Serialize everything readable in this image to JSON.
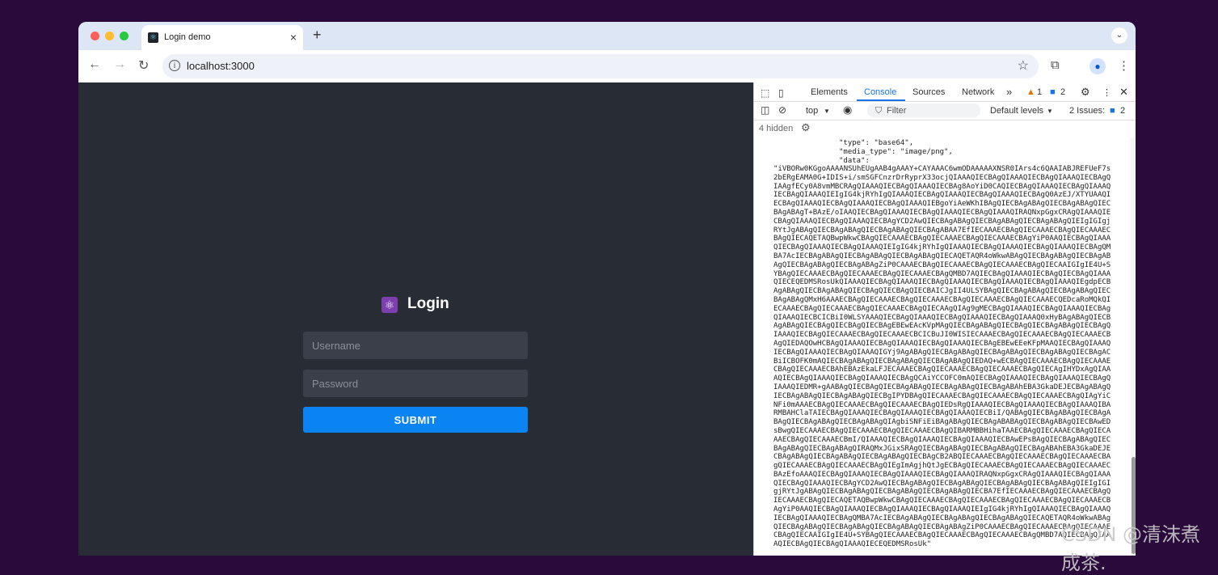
{
  "browser": {
    "tab_title": "Login demo",
    "tab_close": "×",
    "new_tab": "+",
    "tab_menu": "⌄",
    "url": "localhost:3000",
    "colors": {
      "close_dot": "#ff5f57",
      "min_dot": "#febc2e",
      "max_dot": "#28c840"
    }
  },
  "app": {
    "title": "Login",
    "username_placeholder": "Username",
    "password_placeholder": "Password",
    "submit_label": "SUBMIT"
  },
  "devtools": {
    "tabs": [
      "Elements",
      "Console",
      "Sources",
      "Network"
    ],
    "more": "»",
    "warnings": "1",
    "messages": "2",
    "context": "top",
    "filter_placeholder": "Filter",
    "levels": "Default levels",
    "issues_label": "2 Issues:",
    "issues_count": "2",
    "hidden_label": "4 hidden",
    "console": {
      "type_line": "\"type\": \"base64\",",
      "media_line": "\"media_type\": \"image/png\",",
      "data_key": "\"data\":",
      "data_value": "\"iVBORw0KGgoAAAANSUhEUgAAB4gAAAY+CAYAAAC6wmODAAAAAXNSR0IArs4c6QAAIABJREFUeF7s2bERgEAMA0G+IDIS+i/smSGFCnzrDrRyprX33ocjQIAAAQIECBAgQIAAAQIECBAgQIAAAQIECBAgQIAAgfECy0A8vmMBCRAgQIAAAQIECBAgQIAAAQIECBAg8AoYiD0CAQIECBAgQIAAAQIECBAgQIAAAQIECBAgQIAAAQIEIgIG4kjRYhIgQIAAAQIECBAgQIAAAQIECBAgQIAAAQIECBAgQ0AzEJ/XTYUAAQIECBAgQIAAAQIECBAgQIAAAQIECBAgQIAAAQIEBgoYiAeWKhIBAgQIECBAgABAgQIECBAgABAgQIECBAgABAgT+BAzE/oIAAQIECBAgQIAAAQIECBAgQIAAAQIECBAgQIAAAQIRAQNxpGgxCRAgQIAAAQIECBAgQIAAAQIECBAgQIAAAQIECBAgYCD2AwQIECBAgABAgQIECBAgABAgQIECBAgABAgQIEIgIGIgjRYtJgABAgQIECBAgABAgQIECBAgABAgQIECBAgABAA7EfIECAAAECBAgQIECAAAECBAgQIECAAAECBAgQIECAQETAQBwpWkwCBAgQIECAAAECBAgQIECAAAECBAgQIECAAAECBAgYiP0AAQIECBAgQIAAAQIECBAgQIAAAQIECBAgQIAAAQIEIgIG4kjRYhIgQIAAAQIECBAgQIAAAQIECBAgQIAAAQIECBAgQMBA7AcIECBAgABAgQIECBAgABAgQIECBAgABAgQIECAQETAQR4oWkwABAgQIECBAgABAgQIECBAgABAgQIECBAgABAgQIECBAgABAgZiP0CAAAECBAgQIECAAAECBAgQIECAAAECBAgQIECAAIGIgIE4U+SYBAgQIECAAAECBAgQIECAAAECBAgQIECAAAECBAgQMBD7AQIECBAgQIAAAQIECBAgQIECBAgQIAAAQIECEQEDMSRosUkQIAAAQIECBAgQIAAAQIECBAgQIAAAQIECBAgQIAAAQIECBAgQIAAAQIEgdpECBAgABAgQIECBAgABAgQIECBAgQIECBAgQIECBAICJgII4ULSYBAgQIECBAgABAgQIECBAgABAgQIECBAgABAgQMxH6AAAECBAgQIECAAAECBAgQIECAAAECBAgQIECAAAECBAgQIECAAAECQEDcaRoMQkQIECAAAECBAgQIECAAAECBAgQIECAAAECBAgQIECAAgQIAg9gMECBAgQIAAAQIECBAgQIAAAQIECBAgQIAAAQIECBCICBiI0WLSYAAAQIECBAgQIAAAQIECBAgQIAAAQIECBAgQIAAAQ0xHyBAgABAgQIECBAgABAgQIECBAgQIECBAgQIECBAgEBEwEAcKVpMAgQIECBAgABAgQIECBAgQIECBAgABAgQIECBAgQIAAAQIECBAgQIECAAAECBAgQIECAAAECBCICBuJI0WISIECAAAECBAgQIECAAAECBAgQIECAAAECBAgQIEDAQOwHCBAgQIAAAQIECBAgQIAAAQIECBAgQIAAAQIECBAgEBEwEEeKFpMAAQIECBAgQIAAAQIECBAgQIAAAQIECBAgQIAAAQIGYj9AgABAgQIECBAgABAgQIECBAgABAgQIECBAgABAgQIECBAgACBiICBOFK0mAQIECBAgABAgQIECBAgABAgQIECBAgABAgQIEDAQ+wECBAgQIECAAAECBAgQIECAAAECBAgQIECAAAECBAhEBAzEkaLFJECAAAECBAgQIECAAAECBAgQIECAAAECBAgQIECAgIHYDxAgQIAAAQIECBAgQIAAAQIECBAgQIAAAQIECBAgQCAiYCCOFC0mAQIECBAgQIAAAQIECBAgQIAAAQIECBAgQIAAAQIEDMR+gAABAgQIECBAgQIECBAgABAgQIECBAgABAgQIECBAgABAhEBA3GkaDEJECBAgABAgQIECBAgABAgQIECBAgABAgQIECBgIPYDBAgQIECAAAECBAgQIECAAAECBAgQIECAAAECBAgQIAgYiCNFi0mAAAECBAgQIECAAAECBAgQIECAAAECBAgQIEDsRgQIAAAQIECBAgQIAAAQIECBAgQIAAAQIBARMBAHClaTAIECBAgQIAAAQIECBAgQIAAAQIECBAgQIAAAQIECBiI/QABAgQIECBAgABAgQIECBAgABAgQIECBAgABAgQIECBAgABAgQIAgbiSNFiEiBAgABAgQIECBAgABABAgQIECBAgABAgQIECBAwEDsBwgQIECAAAECBAgQIECAAAECBAgQIECAAAECBAgQIBARMBBHihaTAAECBAgQIECAAAECBAgQIECAAAECBAgQIECAAAECBmI/QIAAAQIECBAgQIAAAQIECBAgQIAAAQIECBAwEPsBAgQIECBAgABAgQIECBAgABAgQIECBAgABAgQIRAQMxJGixSRAgQIECBAgABAgQIECBAgABAgQIECBAgABAhEBA3GkaDEJECBAgABAgQIECBAgABAgQIECBAgABAgQIECBAgCB2ABQIECAAAECBAgQIECAAAECBAgQIECAAAECBAgQIECAAAECBAgQIECAAAECBAgQIEgImAgjhQtJgECBAgQIECAAAECBAgQIECAAAECBAgQIECAAAECBAzEfoAAAQIECBAgQIAAAQIECBAgQIAAAQIECBAgQIAAAQIRAQNxpGgxCRAgQIAAAQIECBAgQIAAAQIECBAgQIAAAQIECBAgYCD2AwQIECBAgABAgQIECBAgABAgQIECBAgABAgQIECBAgABAgQIEIgIGIgjRYtJgABAgQIECBAgABAgQIECBAgABAgQIECBAgABAgQIECBA7EfIECAAAECBAgQIECAAAECBAgQIECAAAECBAgQIECAQETAQBwpWkwCBAgQIECAAAECBAgQIECAAAECBAgQIECAAAECBAgQIECAAAECBAgYiP0AAQIECBAgQIAAAQIECBAgQIAAAQIECBAgQIAAAQIEIgIG4kjRYhIgQIAAAQIECBAgQIAAAQIECBAgQIAAAQIECBAgQMBA7AcIECBAgABAgQIECBAgABAgQIECBAgABAgQIECAQETAQR4oWkwABAgQIECBAgABAgQIECBAgABAgQIECBAgABAgQIECBAgABAgZiP0CAAAECBAgQIECAAAECBAgQIECAAAECBAgQIECAAIGIgIE4U+SYBAgQIECAAAECBAgQIECAAAECBAgQIECAAAECBAgQMBD7AQIECBAgQIAAAQIECBAgQIECBAgQIAAAQIECEQEDMSRosUk\""
    }
  },
  "watermark": "CSDN @清沫煮成茶."
}
